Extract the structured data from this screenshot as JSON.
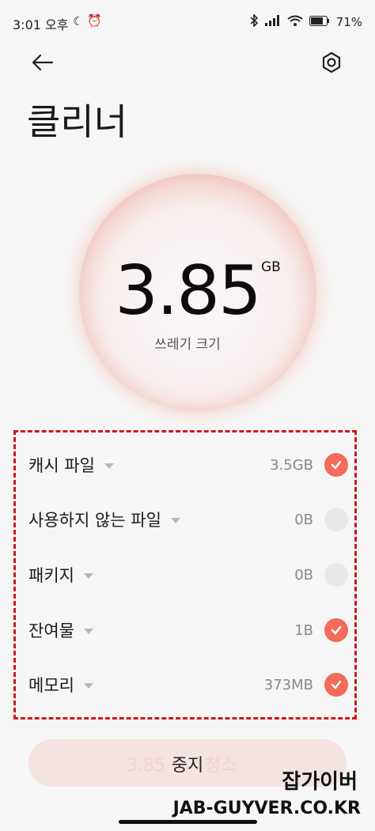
{
  "status_bar": {
    "time": "3:01 오후",
    "battery": "71%"
  },
  "header": {
    "title": "클리너"
  },
  "summary": {
    "value": "3.85",
    "unit": "GB",
    "caption": "쓰레기 크기"
  },
  "items": [
    {
      "label": "캐시 파일",
      "size": "3.5GB",
      "checked": true
    },
    {
      "label": "사용하지 않는 파일",
      "size": "0B",
      "checked": false
    },
    {
      "label": "패키지",
      "size": "0B",
      "checked": false
    },
    {
      "label": "잔여물",
      "size": "1B",
      "checked": true
    },
    {
      "label": "메모리",
      "size": "373MB",
      "checked": true
    }
  ],
  "action": {
    "ghost_label": "3.85",
    "ghost_label2": "청소",
    "label": "중지"
  },
  "watermark": {
    "line1": "잡가이버",
    "line2": "JAB-GUYVER.CO.KR"
  },
  "colors": {
    "accent": "#f26b5b",
    "dashed_box": "#d01818"
  }
}
